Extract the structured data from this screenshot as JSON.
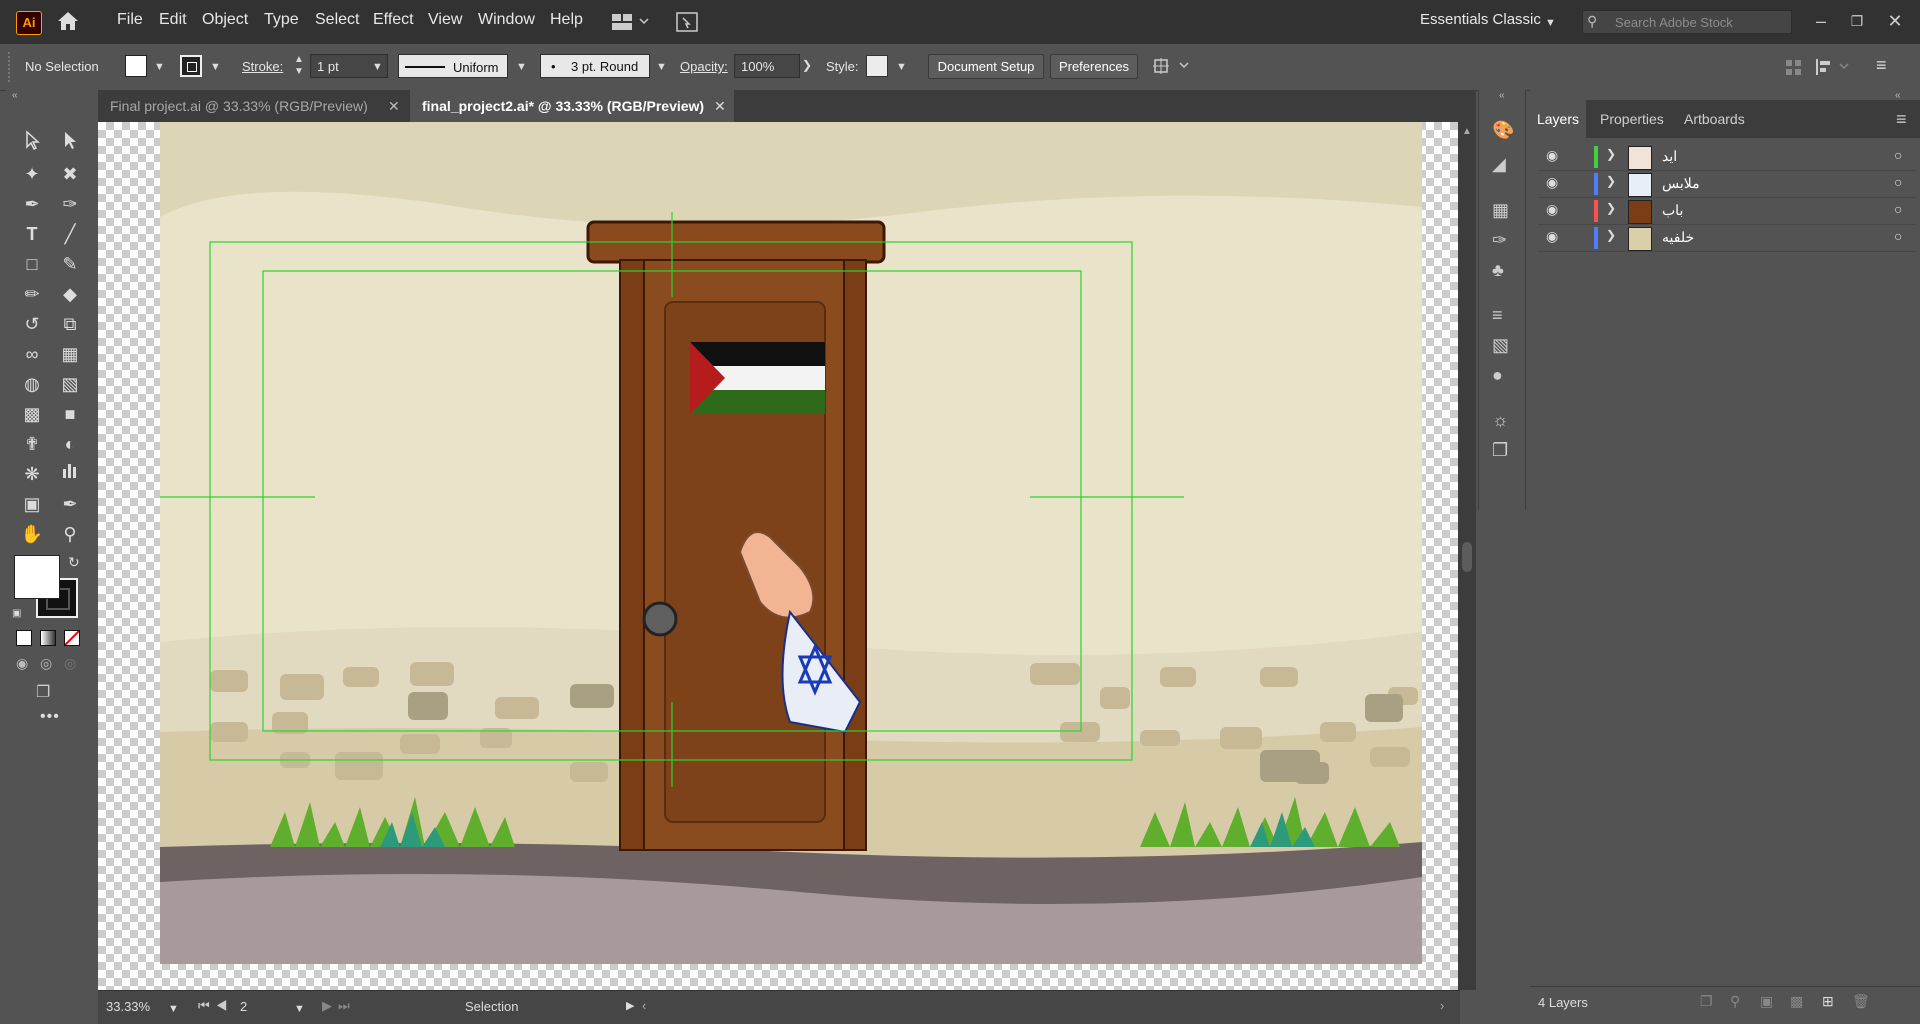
{
  "app": {
    "logo": "Ai",
    "menu": [
      "File",
      "Edit",
      "Object",
      "Type",
      "Select",
      "Effect",
      "View",
      "Window",
      "Help"
    ],
    "workspace": "Essentials Classic",
    "search_placeholder": "Search Adobe Stock"
  },
  "control": {
    "selection": "No Selection",
    "stroke_label": "Stroke:",
    "stroke_weight": "1 pt",
    "profile": "Uniform",
    "brush": "3 pt. Round",
    "opacity_label": "Opacity:",
    "opacity": "100%",
    "style_label": "Style:",
    "document_setup": "Document Setup",
    "preferences": "Preferences"
  },
  "tabs": [
    {
      "label": "Final project.ai @ 33.33% (RGB/Preview)",
      "active": false
    },
    {
      "label": "final_project2.ai* @ 33.33% (RGB/Preview)",
      "active": true
    }
  ],
  "panel": {
    "tabs": [
      "Layers",
      "Properties",
      "Artboards"
    ],
    "layers": [
      {
        "name": "ايد",
        "color": "#3fd13f"
      },
      {
        "name": "ملابس",
        "color": "#4f7fff"
      },
      {
        "name": "باب",
        "color": "#ff5050"
      },
      {
        "name": "خلفيه",
        "color": "#4f7fff"
      }
    ],
    "footer": "4 Layers"
  },
  "status": {
    "zoom": "33.33%",
    "artboard": "2",
    "tool": "Selection"
  },
  "colors": {
    "accent": "#ff9a00",
    "guide": "#2bd42b"
  }
}
